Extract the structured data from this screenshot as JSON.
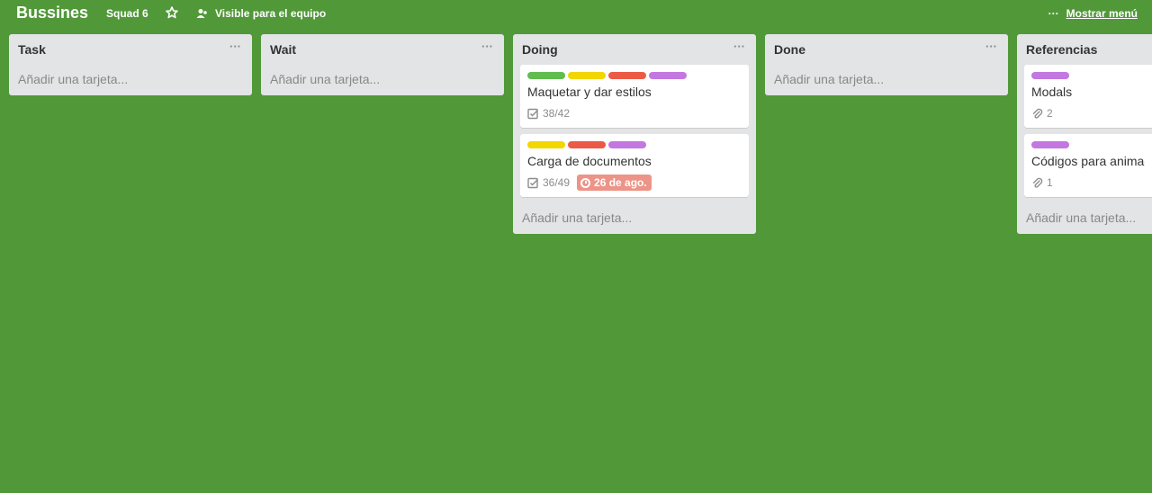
{
  "header": {
    "board_title": "Bussines",
    "team": "Squad 6",
    "star_icon": "star-icon",
    "visibility": "Visible para el equipo",
    "menu_dots": "···",
    "menu_label": "Mostrar menú"
  },
  "colors": {
    "background": "#519839",
    "list": "#e2e4e6",
    "green": "#61bd4f",
    "yellow": "#f2d600",
    "red": "#eb5a46",
    "purple": "#c377e0",
    "due": "#ec9488"
  },
  "lists": [
    {
      "title": "Task",
      "add_label": "Añadir una tarjeta..."
    },
    {
      "title": "Wait",
      "add_label": "Añadir una tarjeta..."
    },
    {
      "title": "Doing",
      "add_label": "Añadir una tarjeta...",
      "cards": [
        {
          "title": "Maquetar y dar estilos",
          "labels": [
            "green",
            "yellow",
            "red",
            "purple"
          ],
          "checklist": "38/42"
        },
        {
          "title": "Carga de documentos",
          "labels": [
            "yellow",
            "red",
            "purple"
          ],
          "checklist": "36/49",
          "due": "26 de ago."
        }
      ]
    },
    {
      "title": "Done",
      "add_label": "Añadir una tarjeta..."
    },
    {
      "title": "Referencias",
      "add_label": "Añadir una tarjeta...",
      "cards": [
        {
          "title": "Modals",
          "labels": [
            "purple"
          ],
          "attachments": "2"
        },
        {
          "title": "Códigos para animaciones",
          "labels": [
            "purple"
          ],
          "attachments": "1"
        }
      ]
    }
  ]
}
